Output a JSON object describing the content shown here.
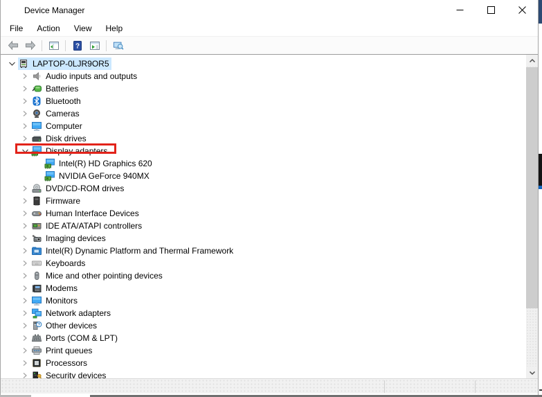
{
  "window": {
    "title": "Device Manager",
    "app_icon": "device-manager-icon",
    "controls": [
      {
        "name": "minimize-button",
        "icon": "minimize-icon"
      },
      {
        "name": "maximize-button",
        "icon": "maximize-icon"
      },
      {
        "name": "close-button",
        "icon": "close-icon"
      }
    ]
  },
  "menu": {
    "items": [
      "File",
      "Action",
      "View",
      "Help"
    ]
  },
  "toolbar": {
    "buttons": [
      {
        "type": "button",
        "name": "back-button",
        "icon": "back-icon"
      },
      {
        "type": "button",
        "name": "forward-button",
        "icon": "forward-icon"
      },
      {
        "type": "separator"
      },
      {
        "type": "button",
        "name": "show-console-tree-button",
        "icon": "console-tree-icon"
      },
      {
        "type": "separator"
      },
      {
        "type": "button",
        "name": "help-button",
        "icon": "help-icon"
      },
      {
        "type": "button",
        "name": "properties-button",
        "icon": "console-play-icon"
      },
      {
        "type": "separator"
      },
      {
        "type": "button",
        "name": "scan-hardware-changes-button",
        "icon": "scan-icon"
      }
    ]
  },
  "tree": {
    "items": [
      {
        "label": "LAPTOP-0LJR9OR5",
        "icon": "computer-root-icon",
        "level": 0,
        "chevron": "expanded",
        "selected": true
      },
      {
        "label": "Audio inputs and outputs",
        "icon": "audio-icon",
        "level": 1,
        "chevron": "collapsed"
      },
      {
        "label": "Batteries",
        "icon": "battery-icon",
        "level": 1,
        "chevron": "collapsed"
      },
      {
        "label": "Bluetooth",
        "icon": "bluetooth-icon",
        "level": 1,
        "chevron": "collapsed"
      },
      {
        "label": "Cameras",
        "icon": "camera-icon",
        "level": 1,
        "chevron": "collapsed"
      },
      {
        "label": "Computer",
        "icon": "monitor-icon",
        "level": 1,
        "chevron": "collapsed"
      },
      {
        "label": "Disk drives",
        "icon": "disk-icon",
        "level": 1,
        "chevron": "collapsed"
      },
      {
        "label": "Display adapters",
        "icon": "display-adapter-icon",
        "level": 1,
        "chevron": "expanded",
        "highlighted": true
      },
      {
        "label": "Intel(R) HD Graphics 620",
        "icon": "display-adapter-icon",
        "level": 2,
        "chevron": "none"
      },
      {
        "label": "NVIDIA GeForce 940MX",
        "icon": "display-adapter-icon",
        "level": 2,
        "chevron": "none"
      },
      {
        "label": "DVD/CD-ROM drives",
        "icon": "dvd-icon",
        "level": 1,
        "chevron": "collapsed"
      },
      {
        "label": "Firmware",
        "icon": "firmware-icon",
        "level": 1,
        "chevron": "collapsed"
      },
      {
        "label": "Human Interface Devices",
        "icon": "hid-icon",
        "level": 1,
        "chevron": "collapsed"
      },
      {
        "label": "IDE ATA/ATAPI controllers",
        "icon": "ide-icon",
        "level": 1,
        "chevron": "collapsed"
      },
      {
        "label": "Imaging devices",
        "icon": "imaging-icon",
        "level": 1,
        "chevron": "collapsed"
      },
      {
        "label": "Intel(R) Dynamic Platform and Thermal Framework",
        "icon": "thermal-icon",
        "level": 1,
        "chevron": "collapsed"
      },
      {
        "label": "Keyboards",
        "icon": "keyboard-icon",
        "level": 1,
        "chevron": "collapsed"
      },
      {
        "label": "Mice and other pointing devices",
        "icon": "mouse-icon",
        "level": 1,
        "chevron": "collapsed"
      },
      {
        "label": "Modems",
        "icon": "modem-icon",
        "level": 1,
        "chevron": "collapsed"
      },
      {
        "label": "Monitors",
        "icon": "monitor-icon",
        "level": 1,
        "chevron": "collapsed"
      },
      {
        "label": "Network adapters",
        "icon": "network-icon",
        "level": 1,
        "chevron": "collapsed"
      },
      {
        "label": "Other devices",
        "icon": "other-device-icon",
        "level": 1,
        "chevron": "collapsed"
      },
      {
        "label": "Ports (COM & LPT)",
        "icon": "ports-icon",
        "level": 1,
        "chevron": "collapsed"
      },
      {
        "label": "Print queues",
        "icon": "printer-icon",
        "level": 1,
        "chevron": "collapsed"
      },
      {
        "label": "Processors",
        "icon": "processor-icon",
        "level": 1,
        "chevron": "collapsed"
      },
      {
        "label": "Security devices",
        "icon": "security-icon",
        "level": 1,
        "chevron": "collapsed"
      }
    ]
  },
  "colors": {
    "selection_highlight": "#cce8ff",
    "annotation_red": "#e2231a",
    "scrollbar_thumb": "#cdcdcd",
    "scrollbar_track": "#f0f0f0",
    "statusbar_bg": "#f1f1f1"
  }
}
